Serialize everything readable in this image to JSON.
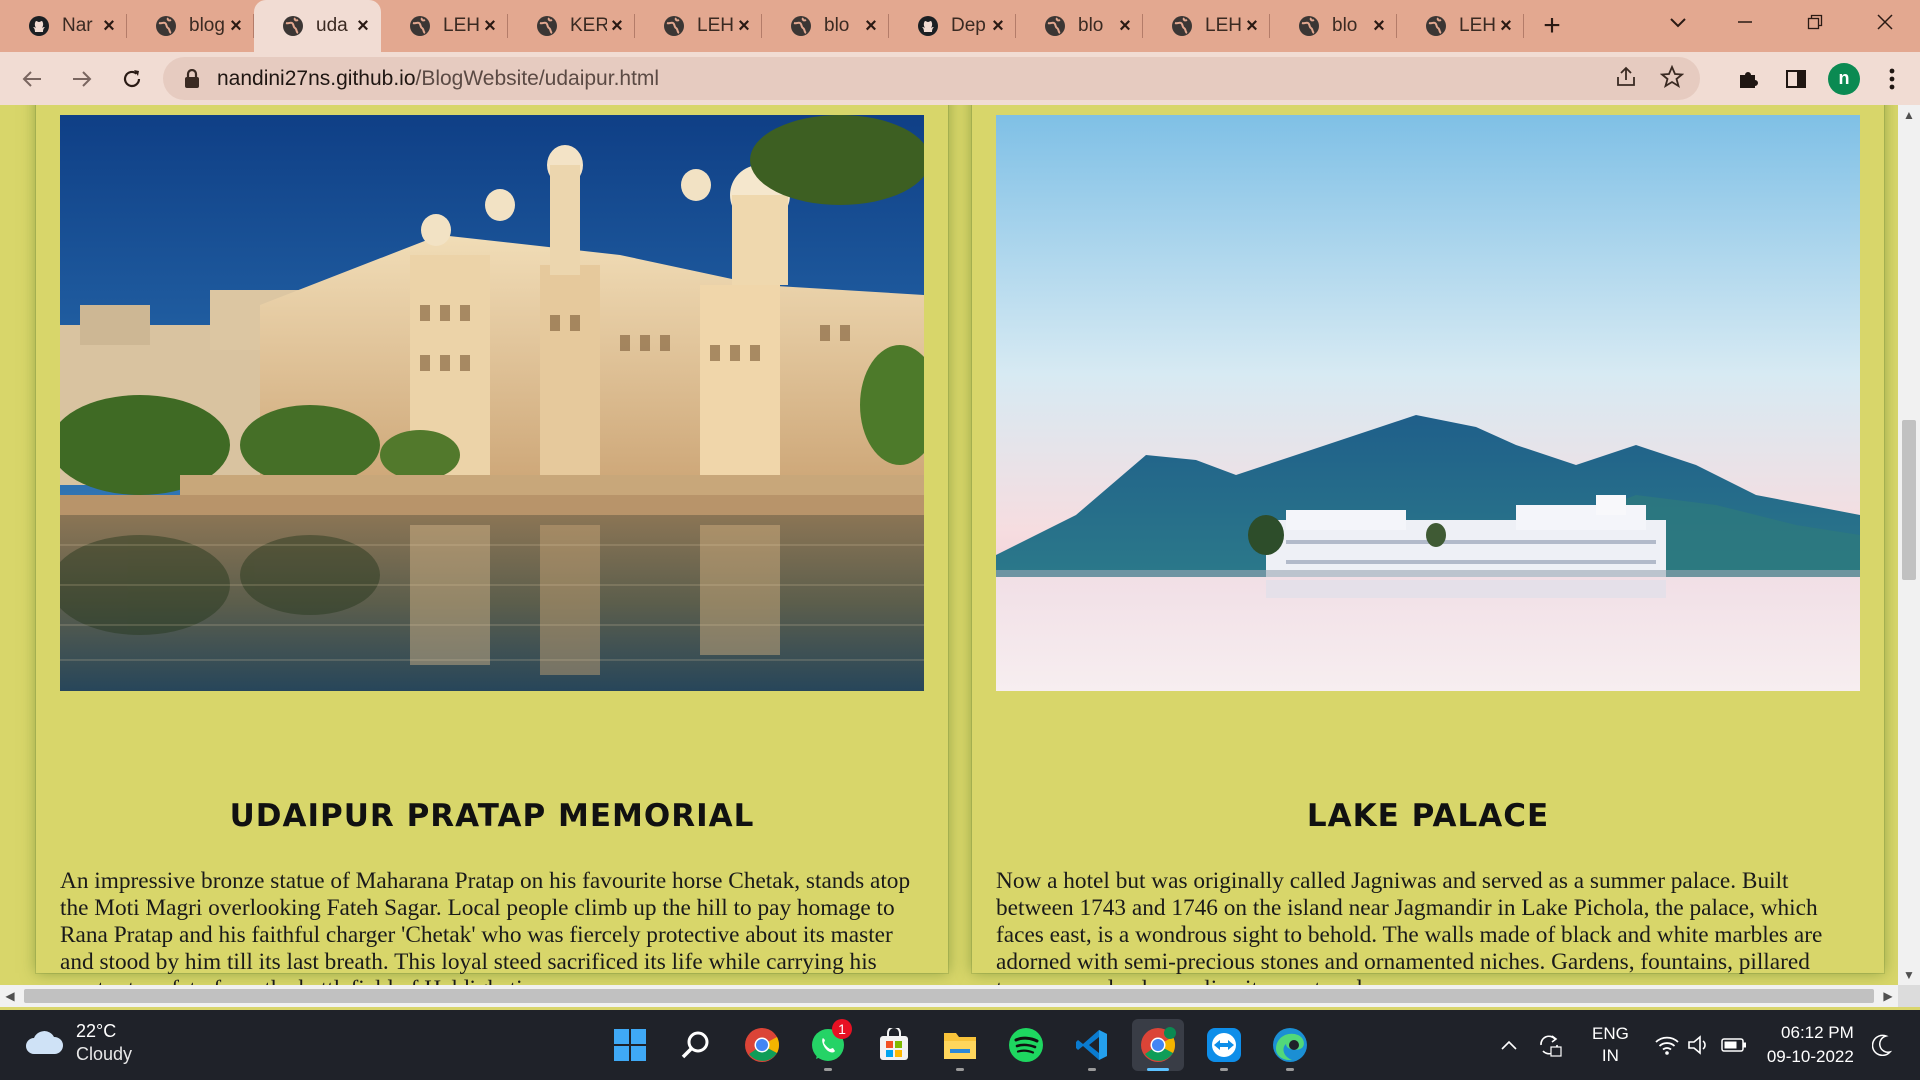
{
  "browser": {
    "tabs": [
      {
        "title": "Nar",
        "icon": "github-icon",
        "active": false
      },
      {
        "title": "blog",
        "icon": "globe-icon",
        "active": false
      },
      {
        "title": "uda",
        "icon": "globe-icon",
        "active": true
      },
      {
        "title": "LEH",
        "icon": "globe-icon",
        "active": false
      },
      {
        "title": "KER",
        "icon": "globe-icon",
        "active": false
      },
      {
        "title": "LEH",
        "icon": "globe-icon",
        "active": false
      },
      {
        "title": "blo",
        "icon": "globe-icon",
        "active": false
      },
      {
        "title": "Dep",
        "icon": "github-icon",
        "active": false
      },
      {
        "title": "blo",
        "icon": "globe-icon",
        "active": false
      },
      {
        "title": "LEH",
        "icon": "globe-icon",
        "active": false
      },
      {
        "title": "blo",
        "icon": "globe-icon",
        "active": false
      },
      {
        "title": "LEH",
        "icon": "globe-icon",
        "active": false
      }
    ],
    "url_host": "nandini27ns.github.io",
    "url_path": "/BlogWebsite/udaipur.html",
    "profile_initial": "n",
    "tab_strip_color": "#e3a890",
    "toolbar_color": "#f1dcd3"
  },
  "page": {
    "background": "#d8d66a",
    "cards": [
      {
        "image_alt": "City Palace Udaipur reflected in Lake Pichola",
        "title": "UDAIPUR PRATAP MEMORIAL",
        "text": "An impressive bronze statue of Maharana Pratap on his favourite horse Chetak, stands atop the Moti Magri overlooking Fateh Sagar. Local people climb up the hill to pay homage to Rana Pratap and his faithful charger 'Chetak' who was fiercely protective about its master and stood by him till its last breath. This loyal steed sacrificed its life while carrying his master to safety from the battlefield of Haldighati."
      },
      {
        "image_alt": "Lake Palace on Lake Pichola with hills behind",
        "title": "LAKE PALACE",
        "text": "Now a hotel but was originally called Jagniwas and served as a summer palace. Built between 1743 and 1746 on the island near Jagmandir in Lake Pichola, the palace, which faces east, is a wondrous sight to behold. The walls made of black and white marbles are adorned with semi-precious stones and ornamented niches. Gardens, fountains, pillared terraces, and columns line its courtyards."
      }
    ]
  },
  "taskbar": {
    "weather_temp": "22°C",
    "weather_condition": "Cloudy",
    "apps": [
      {
        "name": "windows-start-icon",
        "active": false,
        "running": false
      },
      {
        "name": "search-icon",
        "active": false,
        "running": false
      },
      {
        "name": "chrome-icon",
        "active": false,
        "running": false
      },
      {
        "name": "whatsapp-icon",
        "active": false,
        "running": true,
        "badge": "1"
      },
      {
        "name": "microsoft-store-icon",
        "active": false,
        "running": false
      },
      {
        "name": "file-explorer-icon",
        "active": false,
        "running": true
      },
      {
        "name": "spotify-icon",
        "active": false,
        "running": false
      },
      {
        "name": "vscode-icon",
        "active": false,
        "running": true
      },
      {
        "name": "chrome-profile-icon",
        "active": true,
        "running": true
      },
      {
        "name": "teamviewer-icon",
        "active": false,
        "running": true
      },
      {
        "name": "edge-icon",
        "active": false,
        "running": true
      }
    ],
    "lang_top": "ENG",
    "lang_bottom": "IN",
    "time": "06:12 PM",
    "date": "09-10-2022"
  }
}
